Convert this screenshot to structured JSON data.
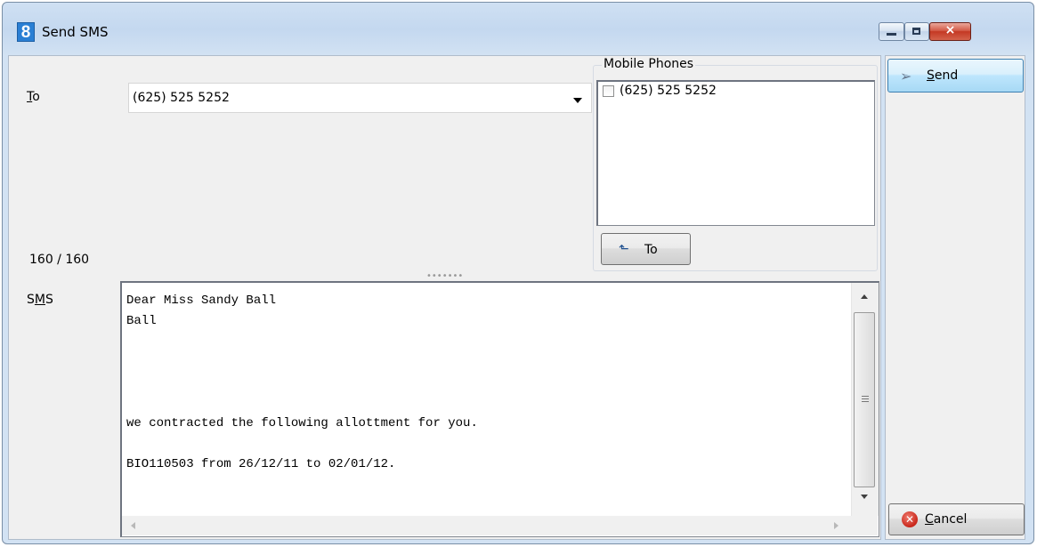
{
  "window": {
    "app_icon_text": "8",
    "title": "Send SMS",
    "controls": {
      "minimize": "minimize",
      "maximize": "maximize",
      "close": "×"
    }
  },
  "form": {
    "to_label_ul": "T",
    "to_label_rest": "o",
    "to_value": "(625) 525 5252",
    "char_counter": "160 / 160",
    "sms_label_s": "S",
    "sms_label_ul": "M",
    "sms_label_rest": "S",
    "sms_body": "Dear Miss Sandy Ball\nBall\n\n\n\n\nwe contracted the following allottment for you.\n\nBIO110503 from 26/12/11 to 02/01/12."
  },
  "mobile_phones": {
    "title": "Mobile Phones",
    "items": [
      {
        "label": "(625) 525 5252",
        "checked": false
      }
    ],
    "to_button": "To"
  },
  "buttons": {
    "send_ul": "S",
    "send_rest": "end",
    "cancel_ul": "C",
    "cancel_rest": "ancel"
  },
  "icons": {
    "app": "app-logo-icon",
    "send": "paper-plane-icon",
    "cancel": "cancel-circle-icon",
    "to": "cursor-arrow-icon"
  },
  "colors": {
    "title_bar": "#c4d8ef",
    "panel": "#f0f0f0",
    "close_button": "#c43823"
  }
}
